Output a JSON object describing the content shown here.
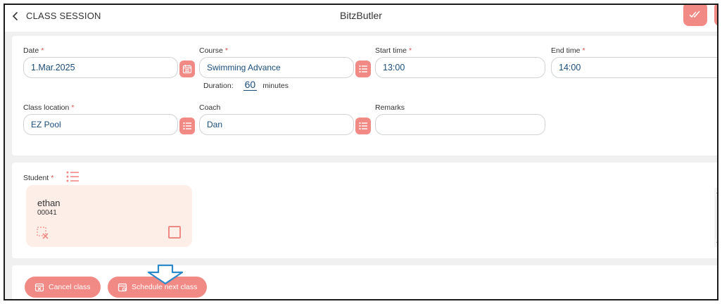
{
  "header": {
    "back_label": "CLASS SESSION",
    "app_name": "BitzButler"
  },
  "form": {
    "date": {
      "label": "Date",
      "required": "*",
      "value": "1.Mar.2025",
      "picker_icon": "calendar-icon"
    },
    "course": {
      "label": "Course",
      "required": "*",
      "value": "Swimming Advance",
      "picker_icon": "list-icon"
    },
    "start_time": {
      "label": "Start time",
      "required": "*",
      "value": "13:00"
    },
    "end_time": {
      "label": "End time",
      "required": "*",
      "value": "14:00"
    },
    "duration": {
      "label": "Duration:",
      "value": "60",
      "unit": "minutes"
    },
    "location": {
      "label": "Class location",
      "required": "*",
      "value": "EZ Pool",
      "picker_icon": "list-icon"
    },
    "coach": {
      "label": "Coach",
      "value": "Dan",
      "picker_icon": "list-icon"
    },
    "remarks": {
      "label": "Remarks",
      "value": ""
    }
  },
  "students": {
    "label": "Student",
    "required": "*",
    "items": [
      {
        "name": "ethan",
        "id": "00041"
      }
    ]
  },
  "actions": {
    "cancel_label": "Cancel class",
    "schedule_label": "Schedule next class"
  },
  "colors": {
    "accent": "#f18a85",
    "value_text": "#1a4d7a",
    "student_card_bg": "#fdeee8",
    "hint_arrow": "#2b88c9"
  }
}
